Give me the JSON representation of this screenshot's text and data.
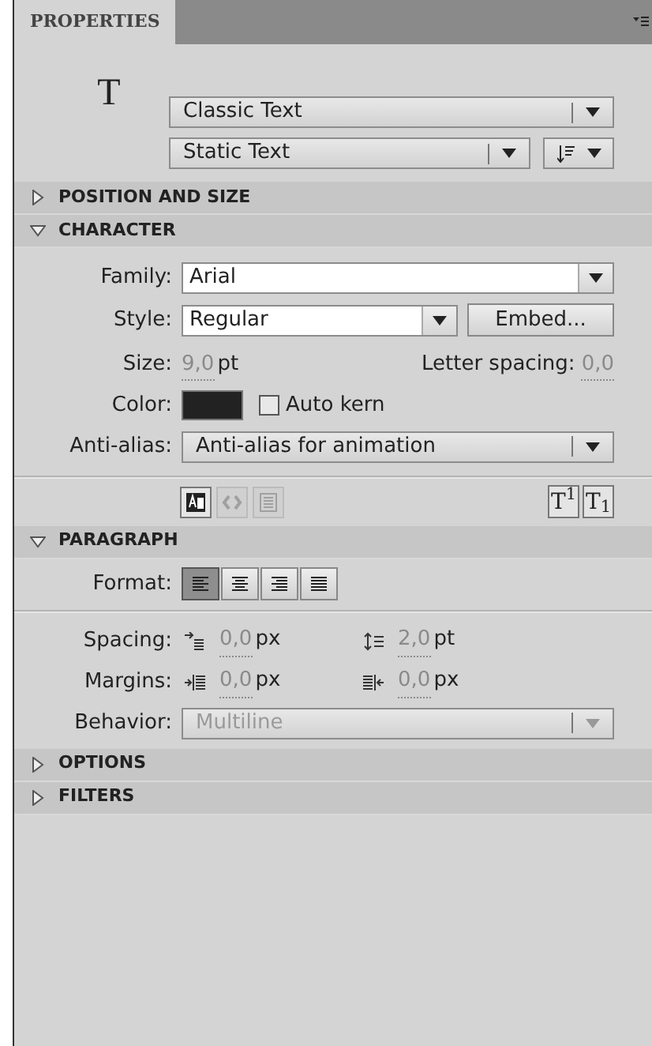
{
  "tab": {
    "label": "PROPERTIES",
    "selected": true
  },
  "tool_glyph": "T",
  "text_engine": {
    "value": "Classic Text"
  },
  "text_type": {
    "value": "Static Text"
  },
  "sections": [
    {
      "title": "POSITION AND SIZE",
      "expanded": false
    },
    {
      "kind": "character",
      "title": "CHARACTER",
      "expanded": true,
      "family": {
        "label": "Family:",
        "value": "Arial"
      },
      "style": {
        "label": "Style:",
        "value": "Regular"
      },
      "embed_button": "Embed...",
      "size": {
        "label": "Size:",
        "value": "9,0",
        "unit": "pt"
      },
      "letter_spacing": {
        "label": "Letter spacing:",
        "value": "0,0"
      },
      "color": {
        "label": "Color:",
        "color": "#222222"
      },
      "auto_kern": {
        "label": "Auto kern",
        "checked": false
      },
      "anti_alias": {
        "label": "Anti-alias:",
        "value": "Anti-alias for animation"
      },
      "toggles": [
        {
          "kind": "selectable",
          "disabled": false
        },
        {
          "kind": "html",
          "disabled": true
        },
        {
          "kind": "border",
          "disabled": true
        }
      ],
      "script_buttons": [
        {
          "text": "T$^{1}$"
        },
        {
          "text": "T$_{1}$"
        }
      ]
    },
    {
      "kind": "paragraph",
      "title": "PARAGRAPH",
      "expanded": true,
      "format": {
        "label": "Format:",
        "aligns": [
          {
            "kind": "left",
            "selected": true
          },
          {
            "kind": "center",
            "selected": false
          },
          {
            "kind": "right",
            "selected": false
          },
          {
            "kind": "justify",
            "selected": false
          }
        ]
      },
      "spacing": {
        "label": "Spacing:",
        "indent": {
          "value": "0,0",
          "unit": "px"
        },
        "line": {
          "value": "2,0",
          "unit": "pt"
        }
      },
      "margins": {
        "label": "Margins:",
        "left": {
          "value": "0,0",
          "unit": "px"
        },
        "right": {
          "value": "0,0",
          "unit": "px"
        }
      },
      "behavior": {
        "label": "Behavior:",
        "value": "Multiline",
        "disabled": true
      }
    },
    {
      "title": "OPTIONS",
      "expanded": false
    },
    {
      "title": "FILTERS",
      "expanded": false
    }
  ]
}
